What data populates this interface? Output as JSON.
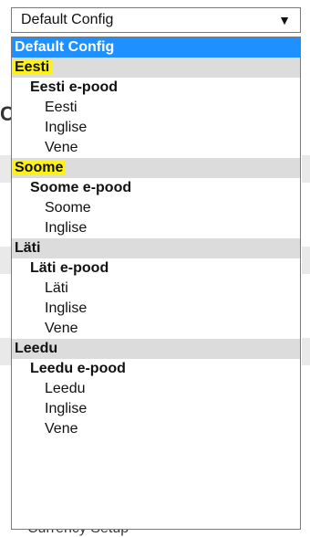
{
  "select": {
    "value": "Default Config",
    "arrow": "▼"
  },
  "options": [
    {
      "label": "Default Config",
      "kind": "selected"
    },
    {
      "label": "Eesti",
      "kind": "group",
      "highlight": true
    },
    {
      "label": "Eesti e-pood",
      "kind": "store"
    },
    {
      "label": "Eesti",
      "kind": "view"
    },
    {
      "label": "Inglise",
      "kind": "view"
    },
    {
      "label": "Vene",
      "kind": "view"
    },
    {
      "label": "Soome",
      "kind": "group",
      "highlight": true
    },
    {
      "label": "Soome e-pood",
      "kind": "store"
    },
    {
      "label": "Soome",
      "kind": "view"
    },
    {
      "label": "Inglise",
      "kind": "view"
    },
    {
      "label": "Läti",
      "kind": "group"
    },
    {
      "label": "Läti e-pood",
      "kind": "store"
    },
    {
      "label": "Läti",
      "kind": "view"
    },
    {
      "label": "Inglise",
      "kind": "view"
    },
    {
      "label": "Vene",
      "kind": "view"
    },
    {
      "label": "Leedu",
      "kind": "group"
    },
    {
      "label": "Leedu e-pood",
      "kind": "store"
    },
    {
      "label": "Leedu",
      "kind": "view"
    },
    {
      "label": "Inglise",
      "kind": "view"
    },
    {
      "label": "Vene",
      "kind": "view"
    }
  ],
  "background": {
    "partial_heading": "C",
    "bottom_text": "Currency Setup"
  },
  "colors": {
    "selected": "#1e90ff",
    "group": "#dcdcdc",
    "highlight": "#fff21a"
  }
}
